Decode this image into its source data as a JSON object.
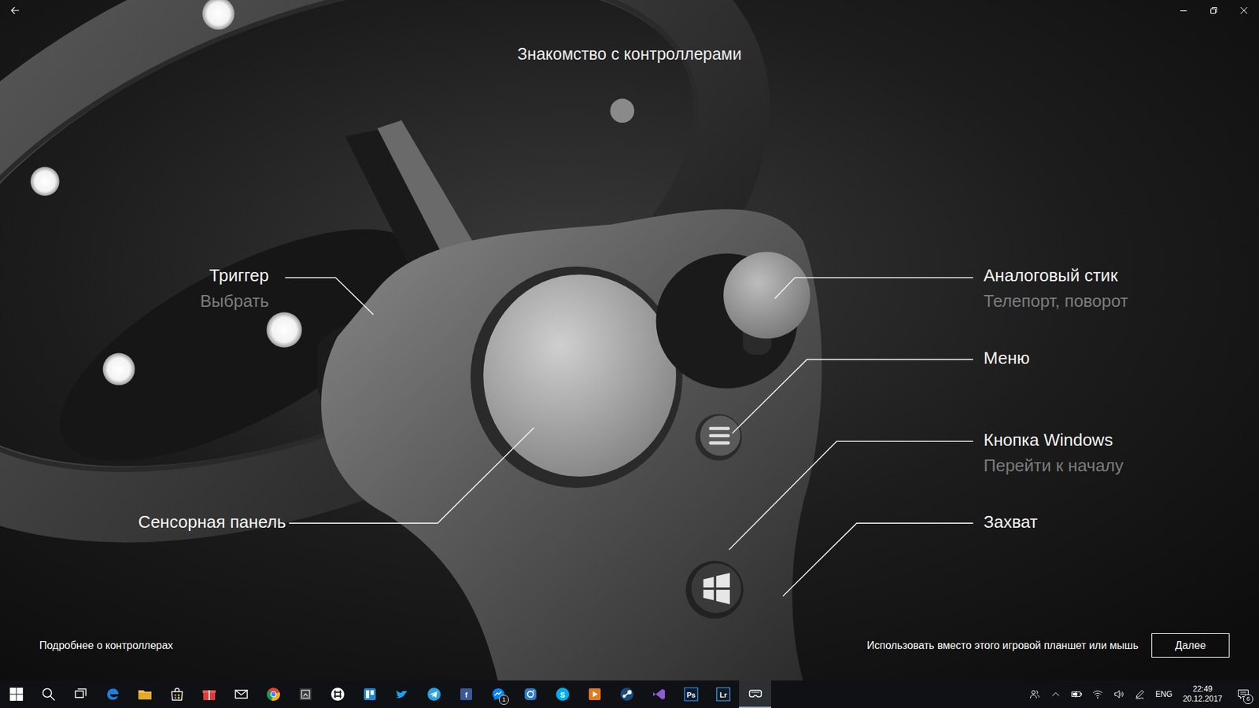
{
  "page": {
    "title": "Знакомство с контроллерами"
  },
  "callouts": [
    {
      "label": "Триггер",
      "hint": "Выбрать",
      "side": "left"
    },
    {
      "label": "Аналоговый стик",
      "hint": "Телепорт, поворот",
      "side": "right"
    },
    {
      "label": "Меню",
      "side": "right"
    },
    {
      "label": "Кнопка Windows",
      "hint": "Перейти к началу",
      "side": "right"
    },
    {
      "label": "Сенсорная панель",
      "side": "left"
    },
    {
      "label": "Захват",
      "side": "right"
    }
  ],
  "footer": {
    "link": "Подробнее о контроллерах",
    "alt_input": "Использовать вместо этого игровой планшет или мышь",
    "button": "Далее"
  },
  "taskbar": {
    "apps": [
      {
        "running": false,
        "active": false
      },
      {
        "running": false,
        "active": false
      },
      {
        "running": false,
        "active": false
      },
      {
        "running": false,
        "active": false
      },
      {
        "running": false,
        "active": false
      },
      {
        "running": false,
        "active": false
      },
      {
        "running": false,
        "active": false
      },
      {
        "running": false,
        "active": false
      },
      {
        "running": false,
        "active": false
      },
      {
        "running": false,
        "active": false
      },
      {
        "running": false,
        "active": false
      },
      {
        "running": false,
        "active": false
      },
      {
        "running": false,
        "active": false
      },
      {
        "running": false,
        "active": false
      },
      {
        "running": false,
        "active": false,
        "label": "f"
      },
      {
        "running": false,
        "active": false,
        "badge": "1"
      },
      {
        "running": false,
        "active": false
      },
      {
        "running": false,
        "active": false,
        "label": "S"
      },
      {
        "running": false,
        "active": false
      },
      {
        "running": false,
        "active": false
      },
      {
        "running": false,
        "active": false
      },
      {
        "running": false,
        "active": false,
        "label": "Ps"
      },
      {
        "running": false,
        "active": false,
        "label": "Lr"
      },
      {
        "running": true,
        "active": true
      }
    ],
    "tray": {
      "language": "ENG",
      "time": "22:49",
      "date": "20.12.2017",
      "notifications": "6"
    }
  }
}
